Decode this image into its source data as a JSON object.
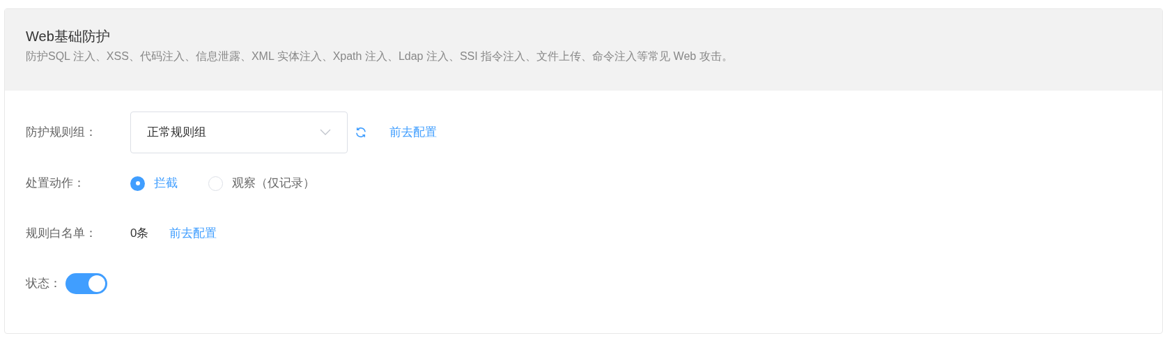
{
  "panel": {
    "title": "Web基础防护",
    "description": "防护SQL 注入、XSS、代码注入、信息泄露、XML 实体注入、Xpath 注入、Ldap 注入、SSI 指令注入、文件上传、命令注入等常见 Web 攻击。"
  },
  "rule_group": {
    "label": "防护规则组：",
    "value": "正常规则组",
    "link": "前去配置"
  },
  "action": {
    "label": "处置动作：",
    "options": [
      {
        "label": "拦截",
        "selected": true
      },
      {
        "label": "观察（仅记录）",
        "selected": false
      }
    ]
  },
  "whitelist": {
    "label": "规则白名单：",
    "count": "0条",
    "link": "前去配置"
  },
  "status": {
    "label": "状态：",
    "on": true
  }
}
